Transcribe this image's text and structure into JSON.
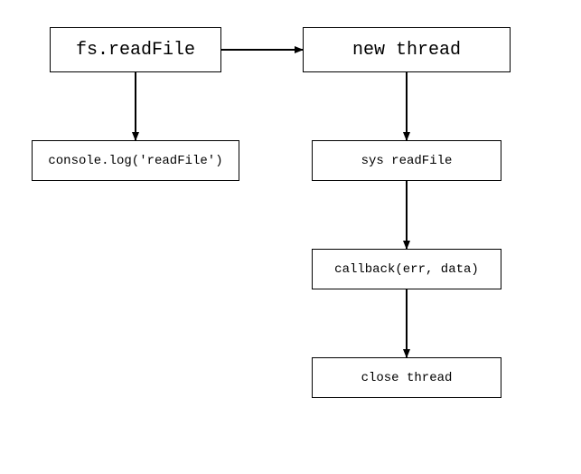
{
  "diagram": {
    "nodes": {
      "fs_readfile": "fs.readFile",
      "new_thread": "new thread",
      "console_log": "console.log('readFile')",
      "sys_readfile": "sys readFile",
      "callback": "callback(err, data)",
      "close_thread": "close thread"
    },
    "edges": [
      {
        "from": "fs_readfile",
        "to": "new_thread"
      },
      {
        "from": "fs_readfile",
        "to": "console_log"
      },
      {
        "from": "new_thread",
        "to": "sys_readfile"
      },
      {
        "from": "sys_readfile",
        "to": "callback"
      },
      {
        "from": "callback",
        "to": "close_thread"
      }
    ]
  }
}
